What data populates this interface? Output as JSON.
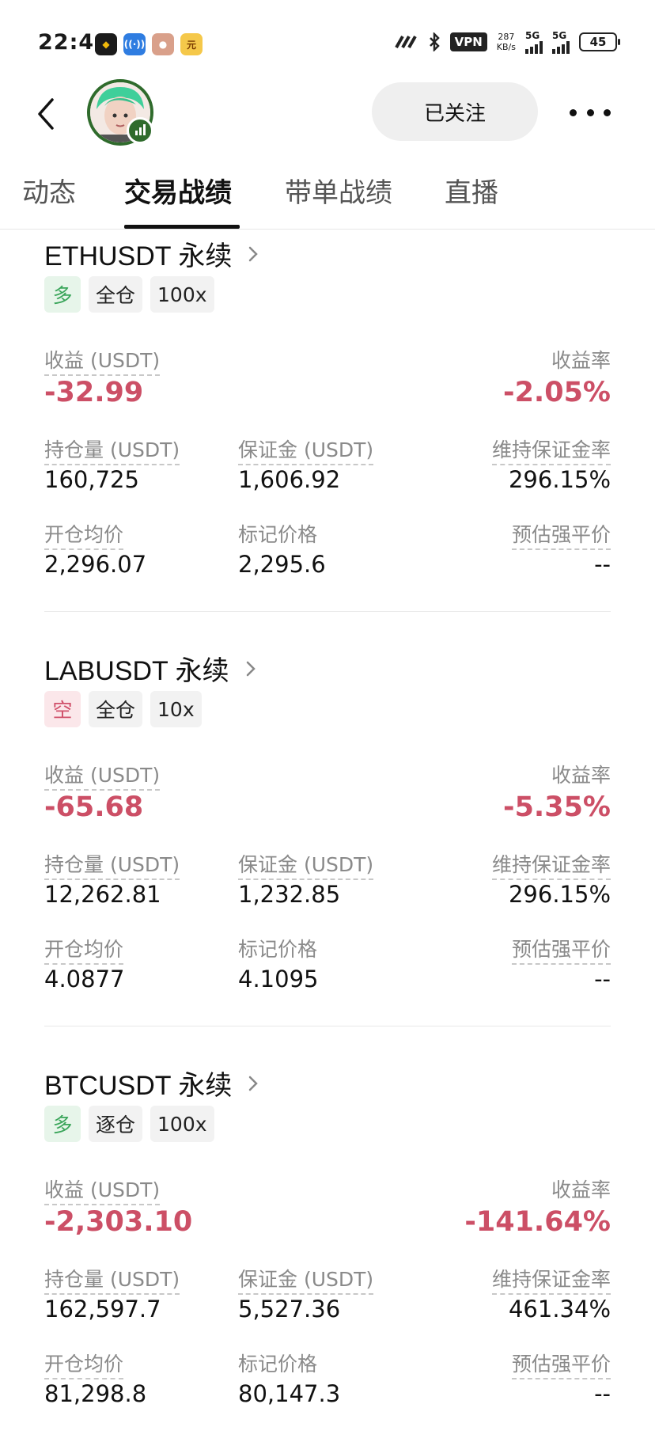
{
  "status_bar": {
    "time": "22:46",
    "vpn": "VPN",
    "speed_value": "287",
    "speed_unit": "KB/s",
    "net1": "5G",
    "net2": "5G",
    "battery": "45"
  },
  "header": {
    "follow_label": "已关注"
  },
  "tabs": [
    {
      "label": "动态",
      "active": false
    },
    {
      "label": "交易战绩",
      "active": true
    },
    {
      "label": "带单战绩",
      "active": false
    },
    {
      "label": "直播",
      "active": false
    }
  ],
  "positions": [
    {
      "symbol": "ETHUSDT 永续",
      "side": "多",
      "margin_mode": "全仓",
      "leverage": "100x",
      "pnl_label": "收益 (USDT)",
      "pnl": "-32.99",
      "roe_label": "收益率",
      "roe": "-2.05%",
      "size_label": "持仓量 (USDT)",
      "size": "160,725",
      "margin_label": "保证金 (USDT)",
      "margin": "1,606.92",
      "mmr_label": "维持保证金率",
      "mmr": "296.15%",
      "entry_label": "开仓均价",
      "entry": "2,296.07",
      "mark_label": "标记价格",
      "mark": "2,295.6",
      "liq_label": "预估强平价",
      "liq": "--"
    },
    {
      "symbol": "LABUSDT 永续",
      "side": "空",
      "margin_mode": "全仓",
      "leverage": "10x",
      "pnl_label": "收益 (USDT)",
      "pnl": "-65.68",
      "roe_label": "收益率",
      "roe": "-5.35%",
      "size_label": "持仓量 (USDT)",
      "size": "12,262.81",
      "margin_label": "保证金 (USDT)",
      "margin": "1,232.85",
      "mmr_label": "维持保证金率",
      "mmr": "296.15%",
      "entry_label": "开仓均价",
      "entry": "4.0877",
      "mark_label": "标记价格",
      "mark": "4.1095",
      "liq_label": "预估强平价",
      "liq": "--"
    },
    {
      "symbol": "BTCUSDT 永续",
      "side": "多",
      "margin_mode": "逐仓",
      "leverage": "100x",
      "pnl_label": "收益 (USDT)",
      "pnl": "-2,303.10",
      "roe_label": "收益率",
      "roe": "-141.64%",
      "size_label": "持仓量 (USDT)",
      "size": "162,597.7",
      "margin_label": "保证金 (USDT)",
      "margin": "5,527.36",
      "mmr_label": "维持保证金率",
      "mmr": "461.34%",
      "entry_label": "开仓均价",
      "entry": "81,298.8",
      "mark_label": "标记价格",
      "mark": "80,147.3",
      "liq_label": "预估强平价",
      "liq": "--"
    }
  ],
  "colors": {
    "loss": "#cc4f66",
    "long": "#3aa55a",
    "short": "#d0506a",
    "avatar_ring": "#2f6b2c"
  }
}
